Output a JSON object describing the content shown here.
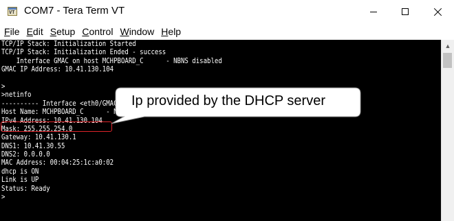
{
  "window": {
    "title": "COM7 - Tera Term VT",
    "app_icon_text": "VT"
  },
  "menu": {
    "items": [
      {
        "key": "F",
        "rest": "ile"
      },
      {
        "key": "E",
        "rest": "dit"
      },
      {
        "key": "S",
        "rest": "etup"
      },
      {
        "key": "C",
        "rest": "ontrol"
      },
      {
        "key": "W",
        "rest": "indow"
      },
      {
        "key": "H",
        "rest": "elp"
      }
    ]
  },
  "terminal": {
    "lines": [
      "TCP/IP Stack: Initialization Started",
      "TCP/IP Stack: Initialization Ended - success",
      "    Interface GMAC on host MCHPBOARD_C      - NBNS disabled",
      "GMAC IP Address: 10.41.130.104",
      "",
      ">",
      ">netinfo",
      "---------- Interface <eth0/GMAC",
      "Host Name: MCHPBOARD_C      - NBNS disable",
      "IPv4 Address: 10.41.130.104",
      "Mask: 255.255.254.0",
      "Gateway: 10.41.130.1",
      "DNS1: 10.41.30.55",
      "DNS2: 0.0.0.0",
      "MAC Address: 00:04:25:1c:a0:02",
      "dhcp is ON",
      "Link is UP",
      "Status: Ready",
      ">"
    ]
  },
  "annotation": {
    "callout_text": "Ip provided by the DHCP server",
    "highlight_color": "#e0242a"
  }
}
